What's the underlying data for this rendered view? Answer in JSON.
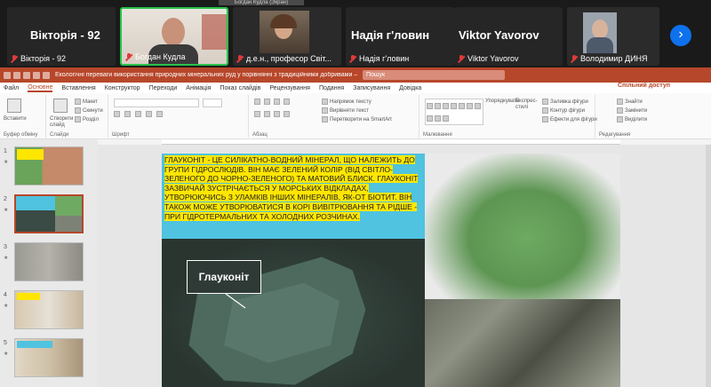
{
  "meeting": {
    "top_label": "Богдан Кудла (Экран)",
    "participants": [
      {
        "big_name": "Вікторія - 92",
        "name": "Вікторія - 92",
        "muted": true,
        "video": false
      },
      {
        "big_name": "",
        "name": "Богдан Кудла",
        "muted": true,
        "video": true,
        "active_speaker": true
      },
      {
        "big_name": "",
        "name": "д.е.н., професор Світ...",
        "muted": true,
        "video": true
      },
      {
        "big_name": "Надія г'ловин",
        "name": "Надія г'ловин",
        "muted": true,
        "video": false
      },
      {
        "big_name": "Viktor Yavorov",
        "name": "Viktor Yavorov",
        "muted": true,
        "video": false
      },
      {
        "big_name": "",
        "name": "Володимир ДИНЯ",
        "muted": true,
        "video": true
      }
    ],
    "next_icon": "chevron-right-icon",
    "accent_color": "#0e72ed"
  },
  "ppt": {
    "window_title": "Екологічні переваги використання природних мінеральних руд у порівнянні з традиційними добривами – PowerPoint",
    "search_placeholder": "Пошук",
    "brand_color": "#b7472a",
    "tabs": [
      "Файл",
      "Основне",
      "Вставлення",
      "Конструктор",
      "Переходи",
      "Анімація",
      "Показ слайдів",
      "Рецензування",
      "Подання",
      "Записування",
      "Довідка"
    ],
    "selected_tab": "Основне",
    "share_label": "Спільний доступ",
    "ribbon": {
      "paste": "Вставити",
      "clipboard_group": "Буфер обміну",
      "new_slide": "Створити слайд",
      "layout": "Макет",
      "reset": "Скинути",
      "section": "Розділ",
      "slides_group": "Слайди",
      "font_group": "Шрифт",
      "paragraph_group": "Абзац",
      "text_direction": "Напрямок тексту",
      "align_text": "Вирівняти текст",
      "smartart": "Перетворити на SmartArt",
      "arrange": "Упорядкувати",
      "quick_styles": "Експрес-стилі",
      "drawing_group": "Малювання",
      "shape_fill": "Заливка фігури",
      "shape_outline": "Контур фігури",
      "shape_effects": "Ефекти для фігури",
      "find": "Знайти",
      "replace": "Замінити",
      "select": "Виділити",
      "editing_group": "Редагування"
    },
    "slides": [
      {
        "number": "1"
      },
      {
        "number": "2",
        "selected": true
      },
      {
        "number": "3"
      },
      {
        "number": "4"
      },
      {
        "number": "5"
      }
    ],
    "current_slide": {
      "text": "Глауконіт - це силікатно-водний мінерал, що належить до групи гідрослюдів. Він має зелений колір (від світло-зеленого до чорно-зеленого) та матовий блиск. Глауконіт зазвичай зустрічається у морських відкладах, утворюючись з уламків інших мінералів, як-от біотит. Він також може утворюватися в корі вивітрювання та рідше - при гідротермальних та холодних розчинах.",
      "callout_label": "Глауконіт"
    }
  }
}
